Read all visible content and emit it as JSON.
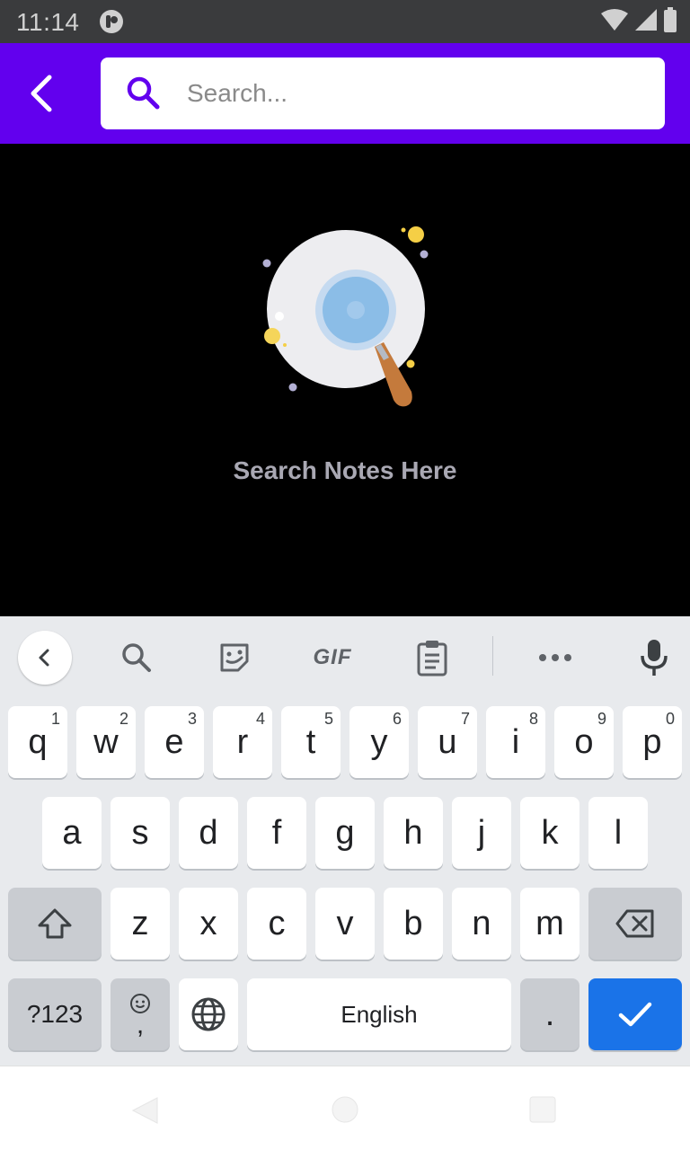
{
  "status_bar": {
    "time": "11:14"
  },
  "app_bar": {
    "search": {
      "placeholder": "Search...",
      "value": ""
    },
    "accent_color": "#6200ee"
  },
  "empty_state": {
    "message": "Search Notes Here"
  },
  "keyboard": {
    "toolbar": {
      "gif_label": "GIF"
    },
    "row1": [
      {
        "label": "q",
        "hint": "1"
      },
      {
        "label": "w",
        "hint": "2"
      },
      {
        "label": "e",
        "hint": "3"
      },
      {
        "label": "r",
        "hint": "4"
      },
      {
        "label": "t",
        "hint": "5"
      },
      {
        "label": "y",
        "hint": "6"
      },
      {
        "label": "u",
        "hint": "7"
      },
      {
        "label": "i",
        "hint": "8"
      },
      {
        "label": "o",
        "hint": "9"
      },
      {
        "label": "p",
        "hint": "0"
      }
    ],
    "row2": [
      "a",
      "s",
      "d",
      "f",
      "g",
      "h",
      "j",
      "k",
      "l"
    ],
    "row3": [
      "z",
      "x",
      "c",
      "v",
      "b",
      "n",
      "m"
    ],
    "symbols_label": "?123",
    "emoji_comma": ",",
    "space_label": "English",
    "period_label": ".",
    "enter_color": "#1a73e8"
  }
}
